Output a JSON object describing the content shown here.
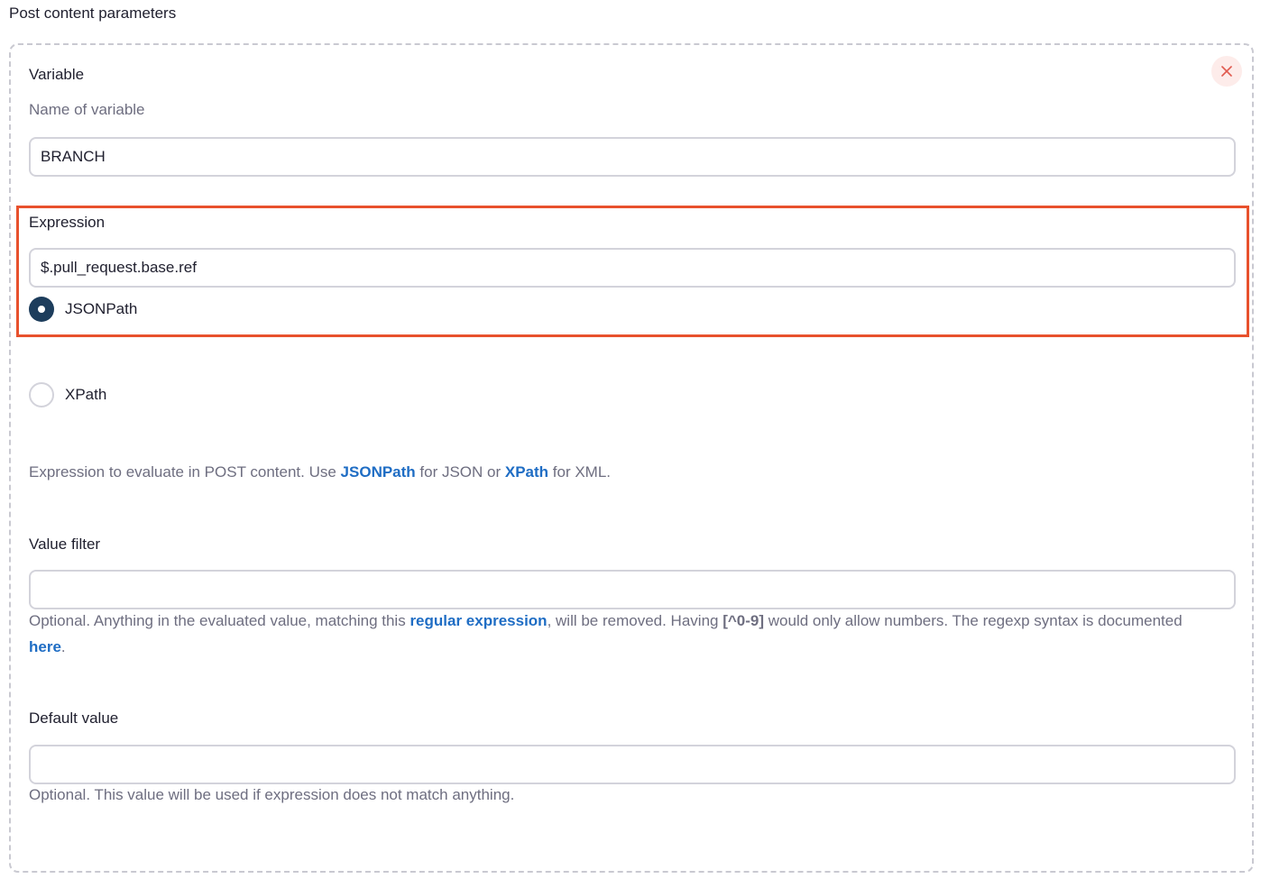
{
  "section": {
    "title": "Post content parameters"
  },
  "variable": {
    "label": "Variable",
    "description": "Name of variable",
    "value": "BRANCH"
  },
  "expression": {
    "label": "Expression",
    "value": "$.pull_request.base.ref",
    "options": [
      {
        "label": "JSONPath",
        "selected": true
      },
      {
        "label": "XPath",
        "selected": false
      }
    ],
    "help": {
      "prefix": "Expression to evaluate in POST content. Use ",
      "link1": "JSONPath",
      "middle": " for JSON or ",
      "link2": "XPath",
      "suffix": " for XML."
    }
  },
  "value_filter": {
    "label": "Value filter",
    "value": "",
    "help": {
      "part1": "Optional. Anything in the evaluated value, matching this ",
      "link1": "regular expression",
      "part2": ", will be removed. Having ",
      "code": "[^0-9]",
      "part3": " would only allow numbers. The regexp syntax is documented ",
      "link2": "here",
      "part4": "."
    }
  },
  "default_value": {
    "label": "Default value",
    "value": "",
    "help": "Optional. This value will be used if expression does not match anything."
  },
  "icons": {
    "delete": "close-icon",
    "delete_color": "#e05a4f"
  },
  "colors": {
    "highlight": "#e8512d",
    "link": "#1f6dc4",
    "radio_selected": "#1d3d5c"
  }
}
